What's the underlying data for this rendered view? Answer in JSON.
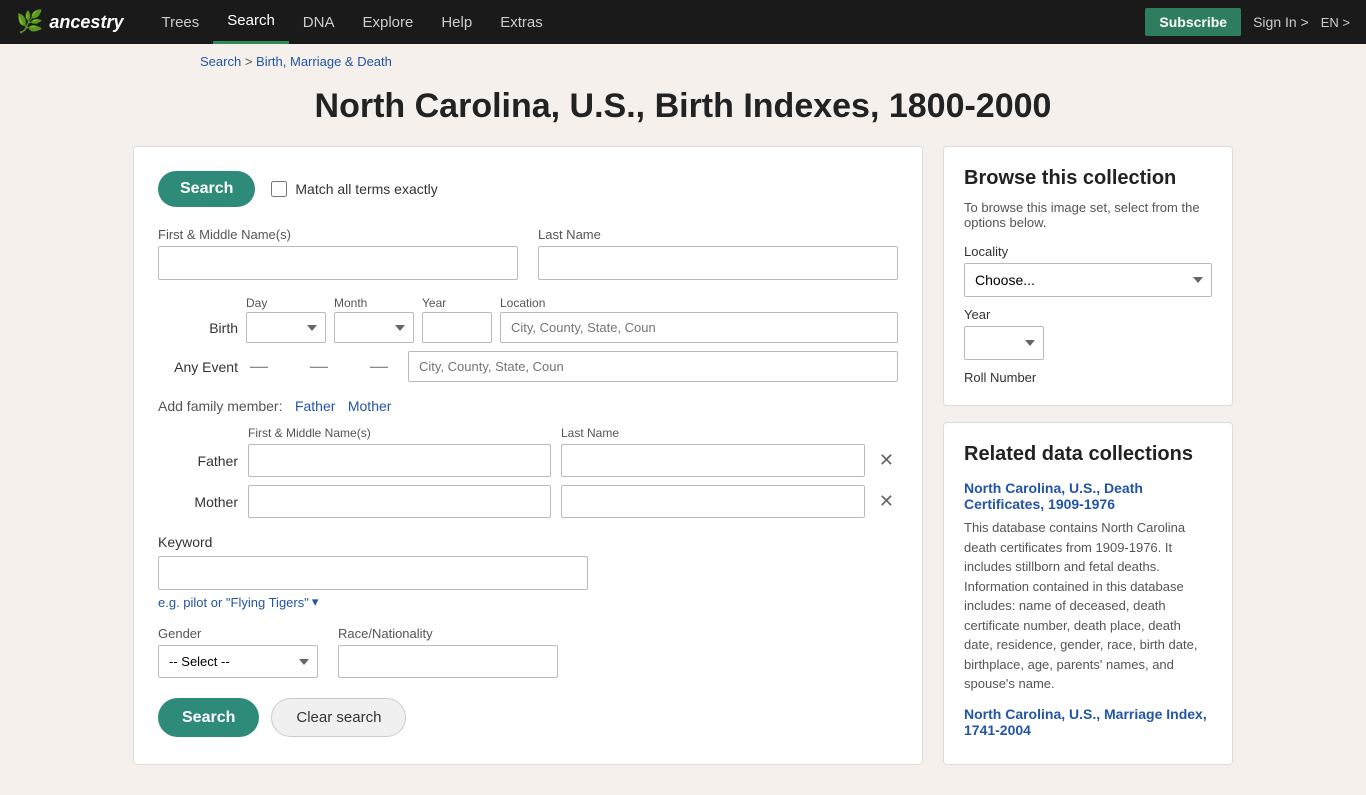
{
  "nav": {
    "logo_symbol": "🌿",
    "logo_text": "ancestry",
    "links": [
      {
        "label": "Trees",
        "active": false
      },
      {
        "label": "Search",
        "active": true
      },
      {
        "label": "DNA",
        "active": false
      },
      {
        "label": "Explore",
        "active": false
      },
      {
        "label": "Help",
        "active": false
      },
      {
        "label": "Extras",
        "active": false
      }
    ],
    "subscribe_label": "Subscribe",
    "signin_label": "Sign In >",
    "lang_label": "EN >"
  },
  "breadcrumb": {
    "search_label": "Search",
    "separator": " > ",
    "section_label": "Birth, Marriage & Death"
  },
  "page_title": "North Carolina, U.S., Birth Indexes, 1800-2000",
  "form": {
    "search_top_label": "Search",
    "match_label": "Match all terms exactly",
    "first_middle_label": "First & Middle Name(s)",
    "last_name_label": "Last Name",
    "birth_label": "Birth",
    "any_event_label": "Any Event",
    "day_label": "Day",
    "month_label": "Month",
    "year_label": "Year",
    "location_label": "Location",
    "location_placeholder": "City, County, State, Coun",
    "add_family_label": "Add family member:",
    "father_link_label": "Father",
    "mother_link_label": "Mother",
    "family_first_middle_label": "First & Middle Name(s)",
    "family_last_name_label": "Last Name",
    "father_label": "Father",
    "mother_label": "Mother",
    "keyword_label": "Keyword",
    "keyword_placeholder": "",
    "keyword_hint": "e.g. pilot or \"Flying Tigers\"",
    "gender_label": "Gender",
    "gender_select_default": "-- Select --",
    "race_nationality_label": "Race/Nationality",
    "search_bottom_label": "Search",
    "clear_label": "Clear search"
  },
  "browse": {
    "title": "Browse this collection",
    "desc": "To browse this image set, select from the options below.",
    "locality_label": "Locality",
    "locality_default": "Choose...",
    "year_label": "Year",
    "roll_number_label": "Roll Number"
  },
  "related": {
    "title": "Related data collections",
    "collections": [
      {
        "link_text": "North Carolina, U.S., Death Certificates, 1909-1976",
        "desc": "This database contains North Carolina death certificates from 1909-1976. It includes stillborn and fetal deaths. Information contained in this database includes: name of deceased, death certificate number, death place, death date, residence, gender, race, birth date, birthplace, age, parents' names, and spouse's name."
      },
      {
        "link_text": "North Carolina, U.S., Marriage Index, 1741-2004",
        "desc": ""
      }
    ]
  }
}
